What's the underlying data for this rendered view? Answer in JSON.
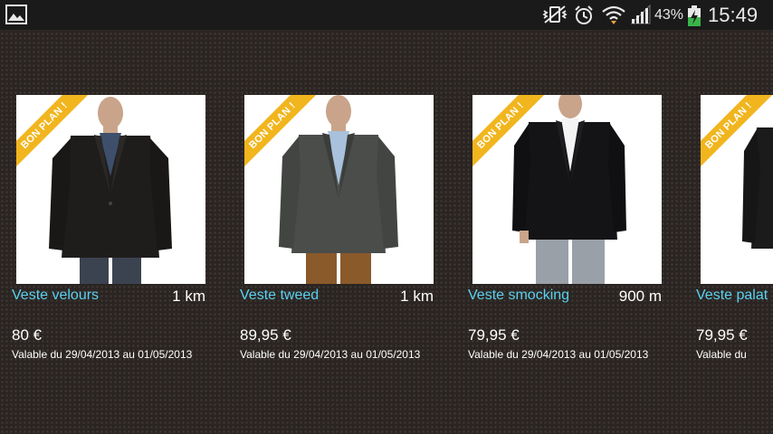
{
  "status_bar": {
    "gallery_icon": "image-icon",
    "icons": [
      "vibrate-mute-icon",
      "alarm-icon",
      "wifi-icon",
      "signal-icon",
      "battery-charging-icon"
    ],
    "battery_percent": "43%",
    "time": "15:49"
  },
  "colors": {
    "accent_title": "#5ad2f2",
    "ribbon": "#f1b51e",
    "background": "#2a2522"
  },
  "offers": [
    {
      "badge": "BON PLAN !",
      "title": "Veste velours",
      "distance": "1 km",
      "price": "80 €",
      "validity": "Valable du 29/04/2013 au 01/05/2013"
    },
    {
      "badge": "BON PLAN !",
      "title": "Veste tweed",
      "distance": "1 km",
      "price": "89,95 €",
      "validity": "Valable du 29/04/2013 au 01/05/2013"
    },
    {
      "badge": "BON PLAN !",
      "title": "Veste smocking",
      "distance": "900 m",
      "price": "79,95 €",
      "validity": "Valable du 29/04/2013 au 01/05/2013"
    },
    {
      "badge": "BON PLAN !",
      "title": "Veste palat",
      "distance": "",
      "price": "79,95 €",
      "validity": "Valable du"
    }
  ]
}
